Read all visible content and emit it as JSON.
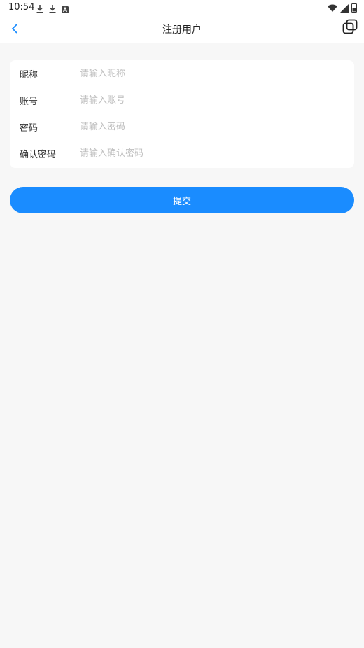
{
  "status_bar": {
    "time": "10:54",
    "left_icons": [
      "download-icon",
      "download-icon",
      "a-box-icon"
    ],
    "right_icons": [
      "wifi-icon",
      "signal-icon",
      "battery-icon"
    ]
  },
  "nav": {
    "title": "注册用户",
    "back_icon": "chevron-left-icon",
    "window_icon": "window-switch-icon",
    "accent_color": "#1a8cff"
  },
  "form": {
    "fields": [
      {
        "label": "昵称",
        "placeholder": "请输入昵称",
        "value": ""
      },
      {
        "label": "账号",
        "placeholder": "请输入账号",
        "value": ""
      },
      {
        "label": "密码",
        "placeholder": "请输入密码",
        "value": ""
      },
      {
        "label": "确认密码",
        "placeholder": "请输入确认密码",
        "value": ""
      }
    ]
  },
  "submit": {
    "label": "提交",
    "color": "#1a8cff"
  }
}
